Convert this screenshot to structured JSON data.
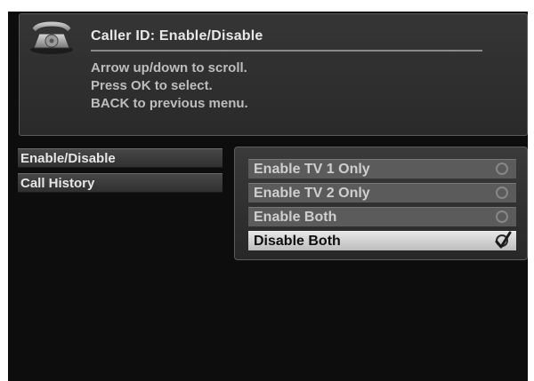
{
  "header": {
    "title": "Caller ID: Enable/Disable",
    "instructions": [
      "Arrow up/down to scroll.",
      "Press OK to select.",
      "BACK to previous menu."
    ],
    "icon": "telephone-icon"
  },
  "left_menu": {
    "items": [
      {
        "label": "Enable/Disable",
        "active": true
      },
      {
        "label": "Call History",
        "active": false
      }
    ]
  },
  "options": {
    "items": [
      {
        "label": "Enable TV 1 Only",
        "checked": false
      },
      {
        "label": "Enable TV 2 Only",
        "checked": false
      },
      {
        "label": "Enable Both",
        "checked": false
      },
      {
        "label": "Disable Both",
        "checked": true
      }
    ],
    "selected_index": 3
  },
  "colors": {
    "background": "#0d0d0d",
    "panel": "#353535",
    "option": "#5b5b5b",
    "option_selected": "#dcdcdc"
  }
}
